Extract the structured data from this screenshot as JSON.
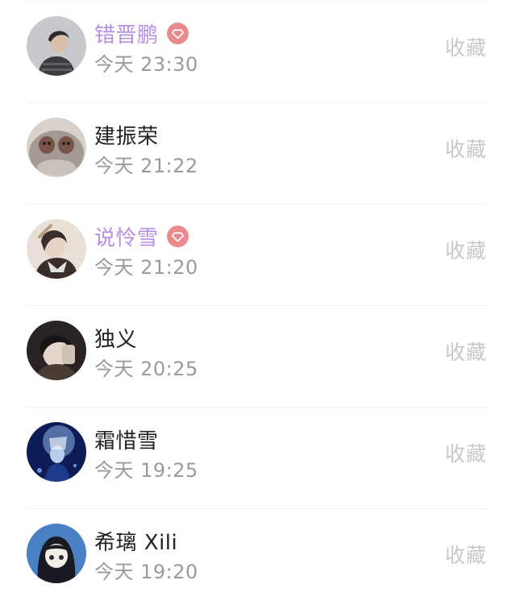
{
  "messages": [
    {
      "name": "错晋鹏",
      "vip": true,
      "time": "今天 23:30",
      "action": "收藏",
      "avatar_colors": [
        "#c7c9cd",
        "#3b3b40",
        "#d8c0aa"
      ]
    },
    {
      "name": "建振荣",
      "vip": false,
      "time": "今天 21:22",
      "action": "收藏",
      "avatar_colors": [
        "#a39a94",
        "#7a5448",
        "#d9d2cc"
      ]
    },
    {
      "name": "说怜雪",
      "vip": true,
      "time": "今天 21:20",
      "action": "收藏",
      "avatar_colors": [
        "#e8dfd6",
        "#3a2e2a",
        "#e6d3c4"
      ]
    },
    {
      "name": "独义",
      "vip": false,
      "time": "今天 20:25",
      "action": "收藏",
      "avatar_colors": [
        "#2a2323",
        "#e5d6cc",
        "#4a3b35"
      ]
    },
    {
      "name": "霜惜雪",
      "vip": false,
      "time": "今天 19:25",
      "action": "收藏",
      "avatar_colors": [
        "#0d1c55",
        "#8fb4e8",
        "#1e3a8a"
      ]
    },
    {
      "name": "希璃 Xili",
      "vip": false,
      "time": "今天 19:20",
      "action": "收藏",
      "avatar_colors": [
        "#4a80c4",
        "#1a1a22",
        "#f3ede8"
      ]
    }
  ]
}
